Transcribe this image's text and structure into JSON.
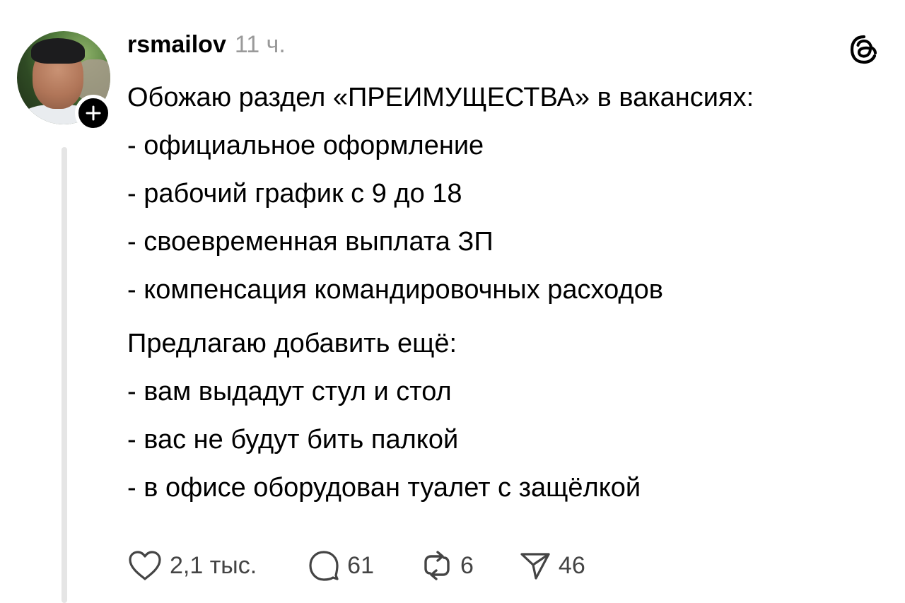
{
  "post": {
    "username": "rsmailov",
    "timestamp": "11 ч.",
    "lines": [
      "Обожаю раздел «ПРЕИМУЩЕСТВА» в вакансиях:",
      "- официальное оформление",
      "- рабочий график с 9 до 18",
      "- своевременная выплата ЗП",
      "- компенсация командировочных расходов"
    ],
    "lines2": [
      "Предлагаю добавить ещё:",
      "- вам выдадут стул и стол",
      "- вас не будут бить палкой",
      "- в офисе оборудован туалет с защёлкой"
    ]
  },
  "actions": {
    "likes": "2,1 тыс.",
    "comments": "61",
    "reposts": "6",
    "shares": "46"
  },
  "icons": {
    "avatar": "profile-photo",
    "follow": "plus-icon",
    "logo": "threads-logo-icon",
    "like": "heart-icon",
    "comment": "comment-bubble-icon",
    "repost": "repost-icon",
    "share": "send-icon"
  },
  "colors": {
    "text": "#000000",
    "muted": "#9a9a9a",
    "action": "#444444",
    "thread_line": "#e5e5e5"
  }
}
